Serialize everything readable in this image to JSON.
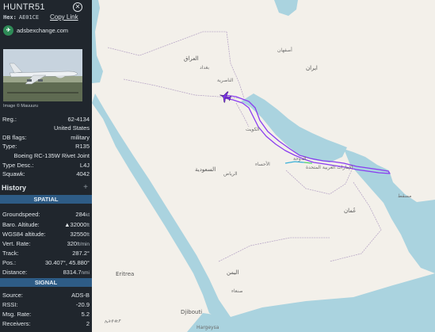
{
  "aircraft": {
    "callsign": "HUNTR51",
    "hex_label": "Hex:",
    "hex": "AE01CE",
    "copy_link": "Copy Link",
    "source_site": "adsbexchange.com",
    "image_credit": "Image © Mauuuru"
  },
  "details": [
    {
      "key": "Reg.:",
      "value": "62-4134"
    },
    {
      "key": "",
      "value": "United States"
    },
    {
      "key": "DB flags:",
      "value": "military"
    },
    {
      "key": "Type:",
      "value": "R135"
    },
    {
      "key": "",
      "value": "Boeing RC-135W Rivet Joint"
    },
    {
      "key": "Type Desc.:",
      "value": "L4J"
    },
    {
      "key": "Squawk:",
      "value": "4042"
    }
  ],
  "history": {
    "label": "History",
    "expand": "+"
  },
  "spatial": {
    "title": "SPATIAL",
    "rows": [
      {
        "key": "Groundspeed:",
        "value": "284",
        "unit": "kt"
      },
      {
        "key": "Baro. Altitude:",
        "value": "▲32000",
        "unit": "ft"
      },
      {
        "key": "WGS84 altitude:",
        "value": "32550",
        "unit": "ft"
      },
      {
        "key": "Vert. Rate:",
        "value": "320",
        "unit": "ft/min"
      },
      {
        "key": "Track:",
        "value": "287.2°",
        "unit": ""
      },
      {
        "key": "Pos.:",
        "value": "30.407°, 45.880°",
        "unit": ""
      },
      {
        "key": "Distance:",
        "value": "8314.7",
        "unit": "nmi"
      }
    ]
  },
  "signal": {
    "title": "SIGNAL",
    "rows": [
      {
        "key": "Source:",
        "value": "ADS-B",
        "unit": ""
      },
      {
        "key": "RSSI:",
        "value": "-20.9",
        "unit": ""
      },
      {
        "key": "Msg. Rate:",
        "value": "5.2",
        "unit": ""
      },
      {
        "key": "Receivers:",
        "value": "2",
        "unit": ""
      }
    ]
  },
  "map_labels": [
    "العراق",
    "بغداد",
    "ایران",
    "الكويت",
    "الرياض",
    "السعودية",
    "الإمارات العربية المتحدة",
    "عُمان",
    "اليمن",
    "Eritrea",
    "Djibouti",
    "Hargeysa",
    "مسقط",
    "الدوحة",
    "أصفهان",
    "الناصرية",
    "الأحساء",
    "صنعاء",
    "ኢትዮጵያ"
  ],
  "colors": {
    "sidebar_bg": "#20262d",
    "section_bg": "#2e5c86",
    "track_color": "#8a3cf0",
    "sea_color": "#aad3df",
    "land_color": "#f3f0ea"
  },
  "icons": {
    "close": "close-icon",
    "adsb_logo": "adsb-logo-icon",
    "aircraft": "aircraft-icon"
  }
}
